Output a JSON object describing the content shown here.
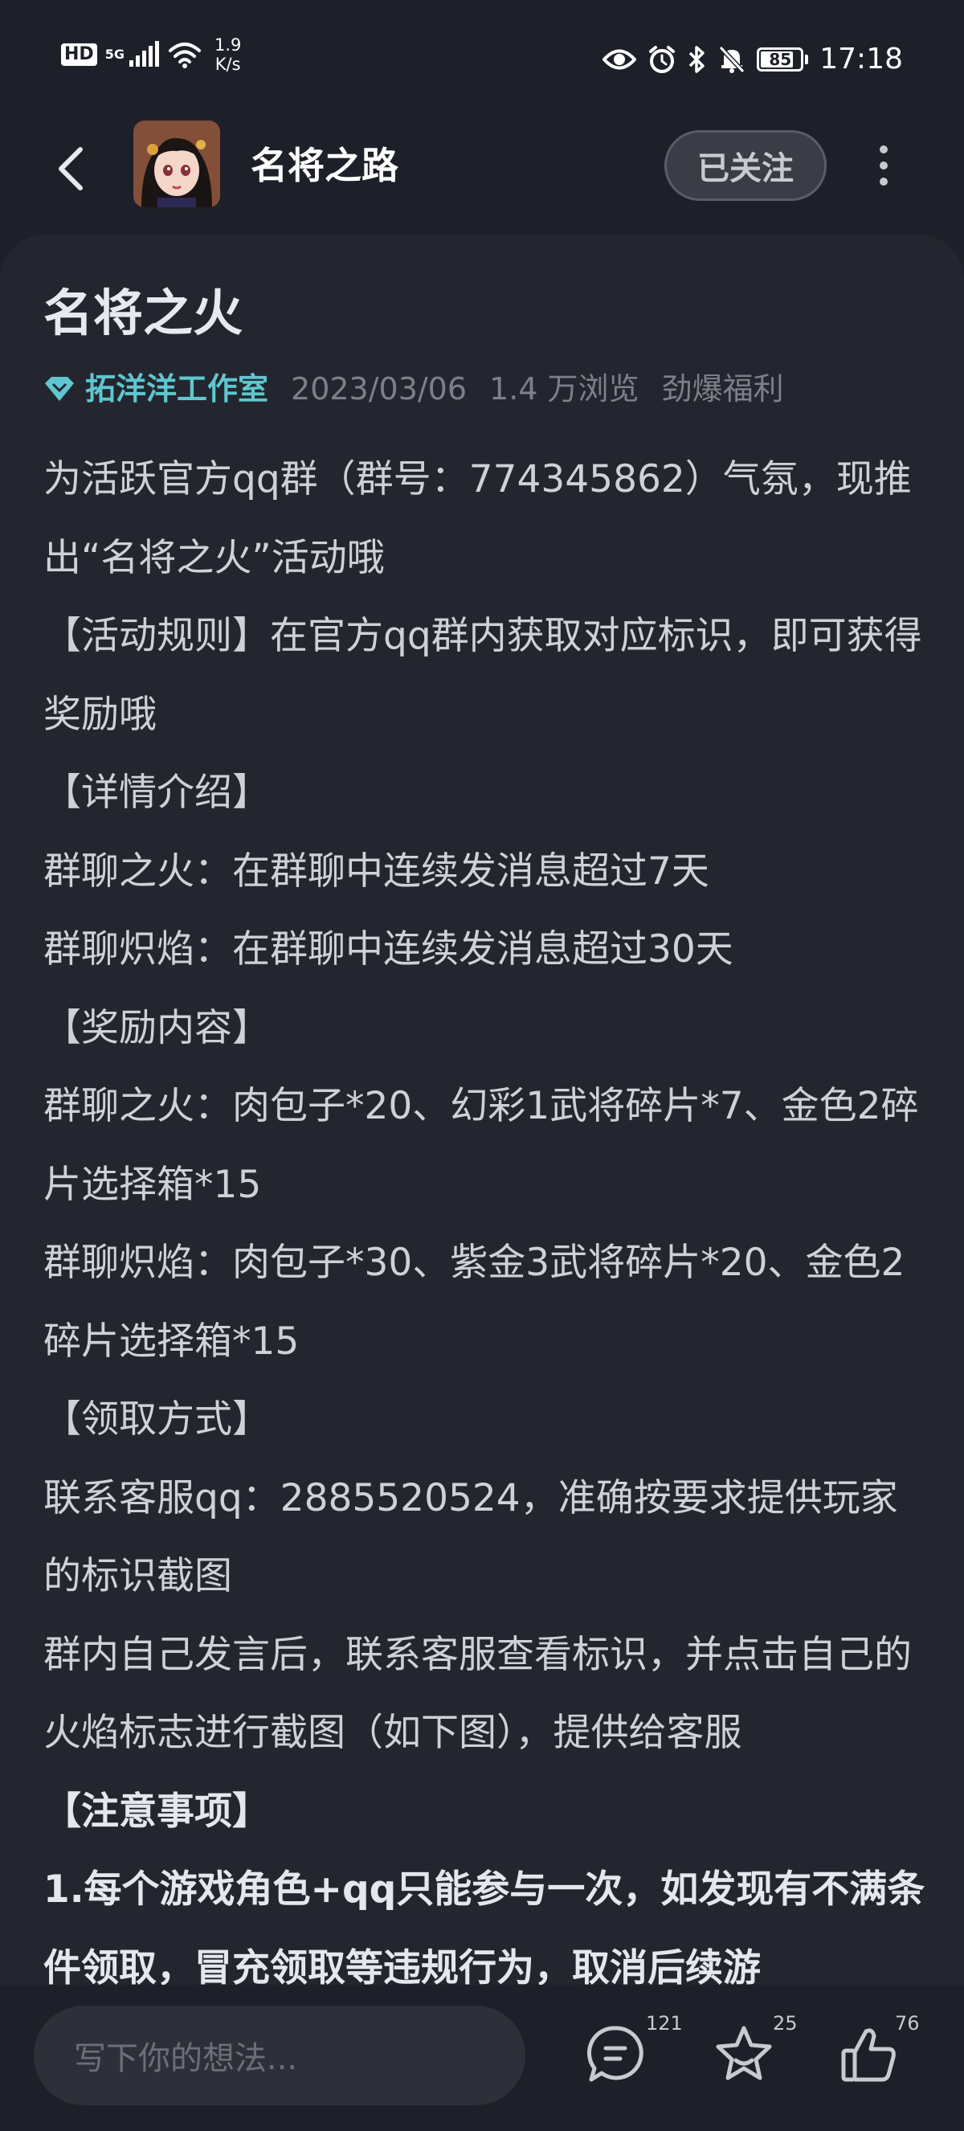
{
  "status_bar": {
    "network_type": "HD",
    "signal_label": "5G",
    "speed_value": "1.9",
    "speed_unit": "K/s",
    "battery_level": "85",
    "battery_fraction": 0.85,
    "time": "17:18",
    "icons": [
      "eye-icon",
      "alarm-icon",
      "bluetooth-icon",
      "mute-icon",
      "battery-icon"
    ]
  },
  "header": {
    "game_name": "名将之路",
    "follow_label": "已关注"
  },
  "article": {
    "title": "名将之火",
    "author": "拓洋洋工作室",
    "date": "2023/03/06",
    "views": "1.4 万浏览",
    "category": "劲爆福利",
    "paragraphs": [
      "为活跃官方qq群（群号：774345862）气氛，现推出“名将之火”活动哦",
      "【活动规则】在官方qq群内获取对应标识，即可获得奖励哦",
      "【详情介绍】",
      "群聊之火：在群聊中连续发消息超过7天",
      "群聊炽焰：在群聊中连续发消息超过30天",
      "【奖励内容】",
      "群聊之火：肉包子*20、幻彩1武将碎片*7、金色2碎片选择箱*15",
      "群聊炽焰：肉包子*30、紫金3武将碎片*20、金色2碎片选择箱*15",
      "【领取方式】",
      "联系客服qq：2885520524，准确按要求提供玩家的标识截图",
      "群内自己发言后，联系客服查看标识，并点击自己的火焰标志进行截图（如下图），提供给客服",
      "【注意事项】",
      "1.每个游戏角色+qq只能参与一次，如发现有不满条件领取，冒充领取等违规行为，取消后续游"
    ]
  },
  "bottom_bar": {
    "comment_placeholder": "写下你的想法...",
    "comment_count": "121",
    "favorite_count": "25",
    "like_count": "76"
  },
  "colors": {
    "background": "#1e2029",
    "card": "#24262f",
    "author_accent": "#5fc7cf",
    "text": "#cfd1d7"
  }
}
